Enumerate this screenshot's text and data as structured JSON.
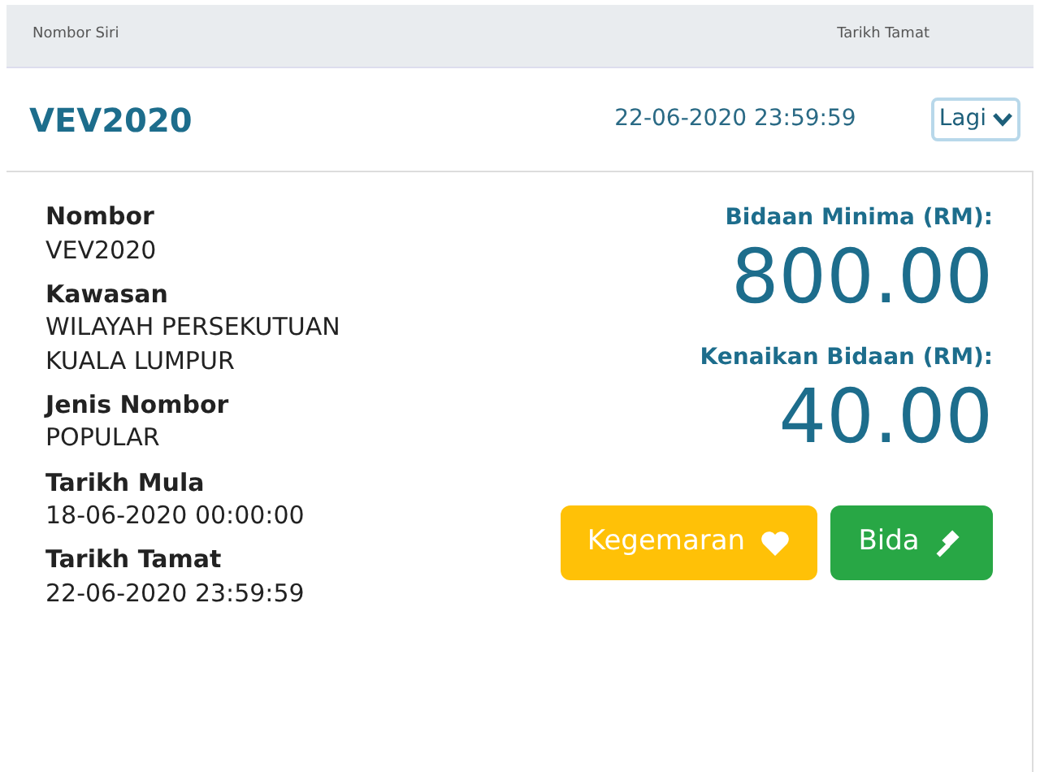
{
  "table_header": {
    "columns": [
      "Nombor Siri",
      "Tarikh Tamat"
    ]
  },
  "row": {
    "number": "VEV2020",
    "end_date": "22-06-2020 23:59:59",
    "more_button": "Lagi"
  },
  "details": [
    {
      "label": "Nombor",
      "value": "VEV2020"
    },
    {
      "label": "Kawasan",
      "value": "WILAYAH PERSEKUTUAN KUALA LUMPUR"
    },
    {
      "label": "Jenis Nombor",
      "value": "POPULAR"
    },
    {
      "label": "Tarikh Mula",
      "value": "18-06-2020 00:00:00"
    },
    {
      "label": "Tarikh Tamat",
      "value": "22-06-2020 23:59:59"
    }
  ],
  "prices": [
    {
      "label": "Bidaan Minima (RM):",
      "amount": "800.00"
    },
    {
      "label": "Kenaikan Bidaan (RM):",
      "amount": "40.00"
    }
  ],
  "buttons": [
    {
      "kind": "favourite",
      "label": "Kegemaran"
    },
    {
      "kind": "bid",
      "label": "Bida"
    }
  ]
}
